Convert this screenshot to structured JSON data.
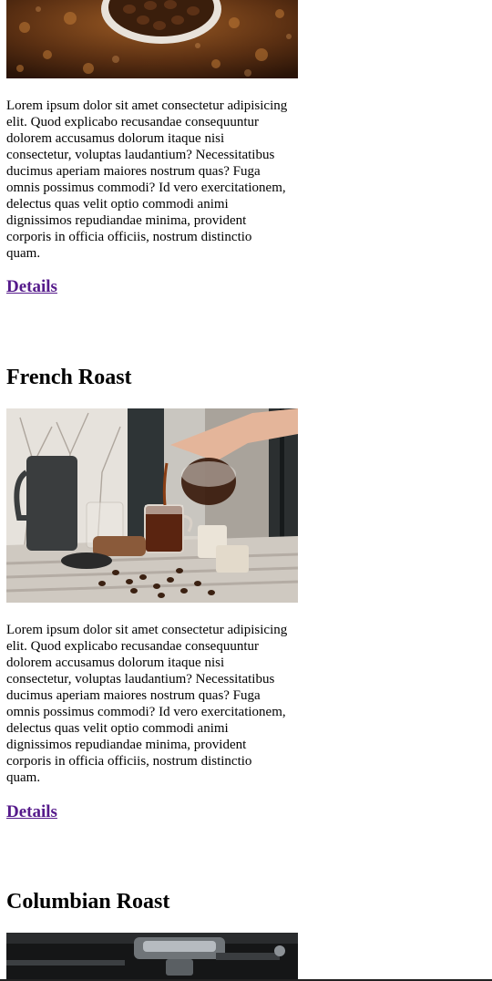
{
  "products": [
    {
      "title": "",
      "image_alt": "coffee-beans-bowl-image",
      "description": "Lorem ipsum dolor sit amet consectetur adipisicing elit. Quod explicabo recusandae consequuntur dolorem accusamus dolorum itaque nisi consectetur, voluptas laudantium? Necessitatibus ducimus aperiam maiores nostrum quas? Fuga omnis possimus commodi? Id vero exercitationem, delectus quas velit optio commodi animi dignissimos repudiandae minima, provident corporis in officia officiis, nostrum distinctio quam.",
      "link_label": "Details"
    },
    {
      "title": "French Roast",
      "image_alt": "french-press-pouring-image",
      "description": "Lorem ipsum dolor sit amet consectetur adipisicing elit. Quod explicabo recusandae consequuntur dolorem accusamus dolorum itaque nisi consectetur, voluptas laudantium? Necessitatibus ducimus aperiam maiores nostrum quas? Fuga omnis possimus commodi? Id vero exercitationem, delectus quas velit optio commodi animi dignissimos repudiandae minima, provident corporis in officia officiis, nostrum distinctio quam.",
      "link_label": "Details"
    },
    {
      "title": "Columbian Roast",
      "image_alt": "espresso-machine-image"
    }
  ],
  "colors": {
    "link": "#551a8b",
    "text": "#000000",
    "background": "#ffffff"
  }
}
